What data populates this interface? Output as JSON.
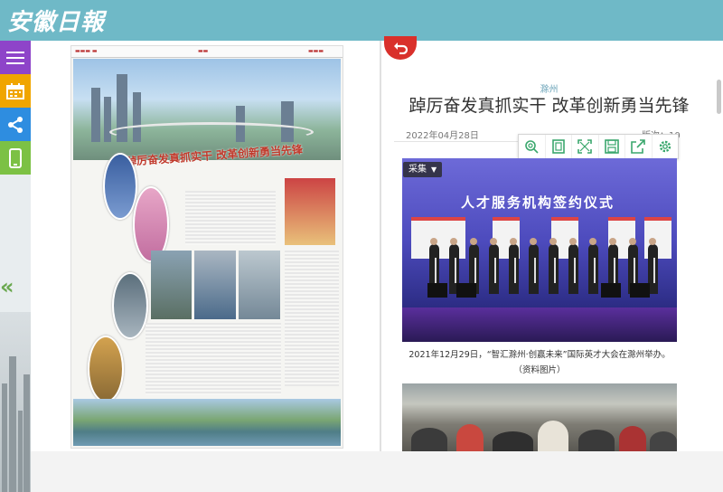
{
  "header": {
    "logo_text": "安徽日報"
  },
  "sidebar": {
    "items": [
      {
        "name": "menu",
        "icon": "hamburger-menu-icon",
        "color": "#8e44c9"
      },
      {
        "name": "calendar",
        "icon": "calendar-icon",
        "color": "#f0a500"
      },
      {
        "name": "share",
        "icon": "share-icon",
        "color": "#2e8de0"
      },
      {
        "name": "mobile",
        "icon": "mobile-phone-icon",
        "color": "#7cc144"
      }
    ],
    "collapse_glyph": "«"
  },
  "newspaper": {
    "headline": "踔厉奋发真抓实干 改革创新勇当先锋"
  },
  "article": {
    "section": "滁州",
    "title": "踔厉奋发真抓实干 改革创新勇当先锋",
    "date": "2022年04月28日",
    "page": "版次：10",
    "toolbar": [
      "zoom-search-icon",
      "fit-page-icon",
      "fullscreen-icon",
      "save-icon",
      "export-icon",
      "settings-icon"
    ],
    "image_tag": "采集",
    "photo_banner": "人才服务机构签约仪式",
    "caption_line1": "2021年12月29日，“智汇滁州·创赢未来”国际英才大会在滁州举办。",
    "caption_line2": "（资料图片）"
  },
  "colors": {
    "topbar": "#6fb9c7",
    "accent_red": "#d9302b",
    "section": "#6aa3b8"
  }
}
